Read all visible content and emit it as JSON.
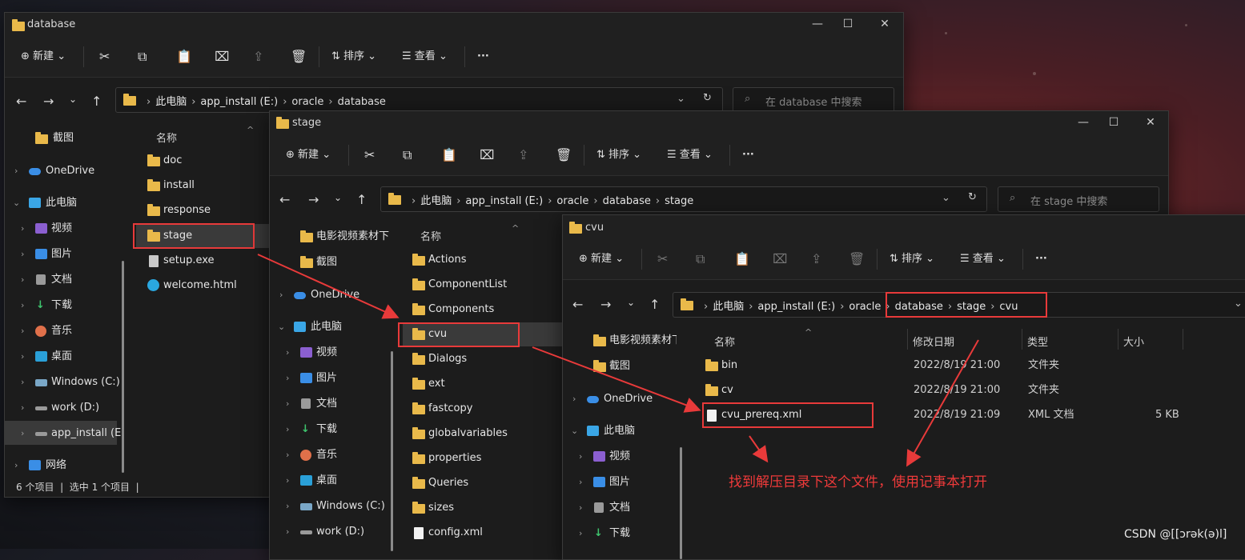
{
  "common": {
    "new": "新建",
    "sort": "排序",
    "view": "查看",
    "more": "···",
    "name_col": "名称",
    "this_pc": "此电脑",
    "drive": "app_install (E:)",
    "oracle": "oracle",
    "database": "database",
    "stage": "stage",
    "cvu": "cvu"
  },
  "win1": {
    "title": "database",
    "search_placeholder": "在 database 中搜索",
    "nav": [
      "截图",
      "OneDrive",
      "此电脑",
      "视频",
      "图片",
      "文档",
      "下载",
      "音乐",
      "桌面",
      "Windows (C:)",
      "work (D:)",
      "app_install (E:",
      "网络"
    ],
    "files": [
      "doc",
      "install",
      "response",
      "stage",
      "setup.exe",
      "welcome.html"
    ],
    "status": {
      "count": "6 个项目",
      "selected": "选中 1 个项目"
    }
  },
  "win2": {
    "title": "stage",
    "search_placeholder": "在 stage 中搜索",
    "nav": [
      "电影视频素材下",
      "截图",
      "OneDrive",
      "此电脑",
      "视频",
      "图片",
      "文档",
      "下载",
      "音乐",
      "桌面",
      "Windows (C:)",
      "work (D:)"
    ],
    "files": [
      "Actions",
      "ComponentList",
      "Components",
      "cvu",
      "Dialogs",
      "ext",
      "fastcopy",
      "globalvariables",
      "properties",
      "Queries",
      "sizes",
      "config.xml"
    ]
  },
  "win3": {
    "title": "cvu",
    "nav": [
      "电影视频素材下",
      "截图",
      "OneDrive",
      "此电脑",
      "视频",
      "图片",
      "文档",
      "下载"
    ],
    "columns": {
      "name": "名称",
      "modified": "修改日期",
      "type": "类型",
      "size": "大小"
    },
    "rows": [
      {
        "name": "bin",
        "date": "2022/8/19 21:00",
        "type": "文件夹",
        "size": ""
      },
      {
        "name": "cv",
        "date": "2022/8/19 21:00",
        "type": "文件夹",
        "size": ""
      },
      {
        "name": "cvu_prereq.xml",
        "date": "2022/8/19 21:09",
        "type": "XML 文档",
        "size": "5 KB"
      }
    ]
  },
  "annotation": "找到解压目录下这个文件，使用记事本打开",
  "watermark": "CSDN @[[ɔrək(ə)l]",
  "colors": {
    "folder": "#e9b94a",
    "annotation_red": "#e83a3a",
    "window_bg": "#1c1c1c"
  }
}
